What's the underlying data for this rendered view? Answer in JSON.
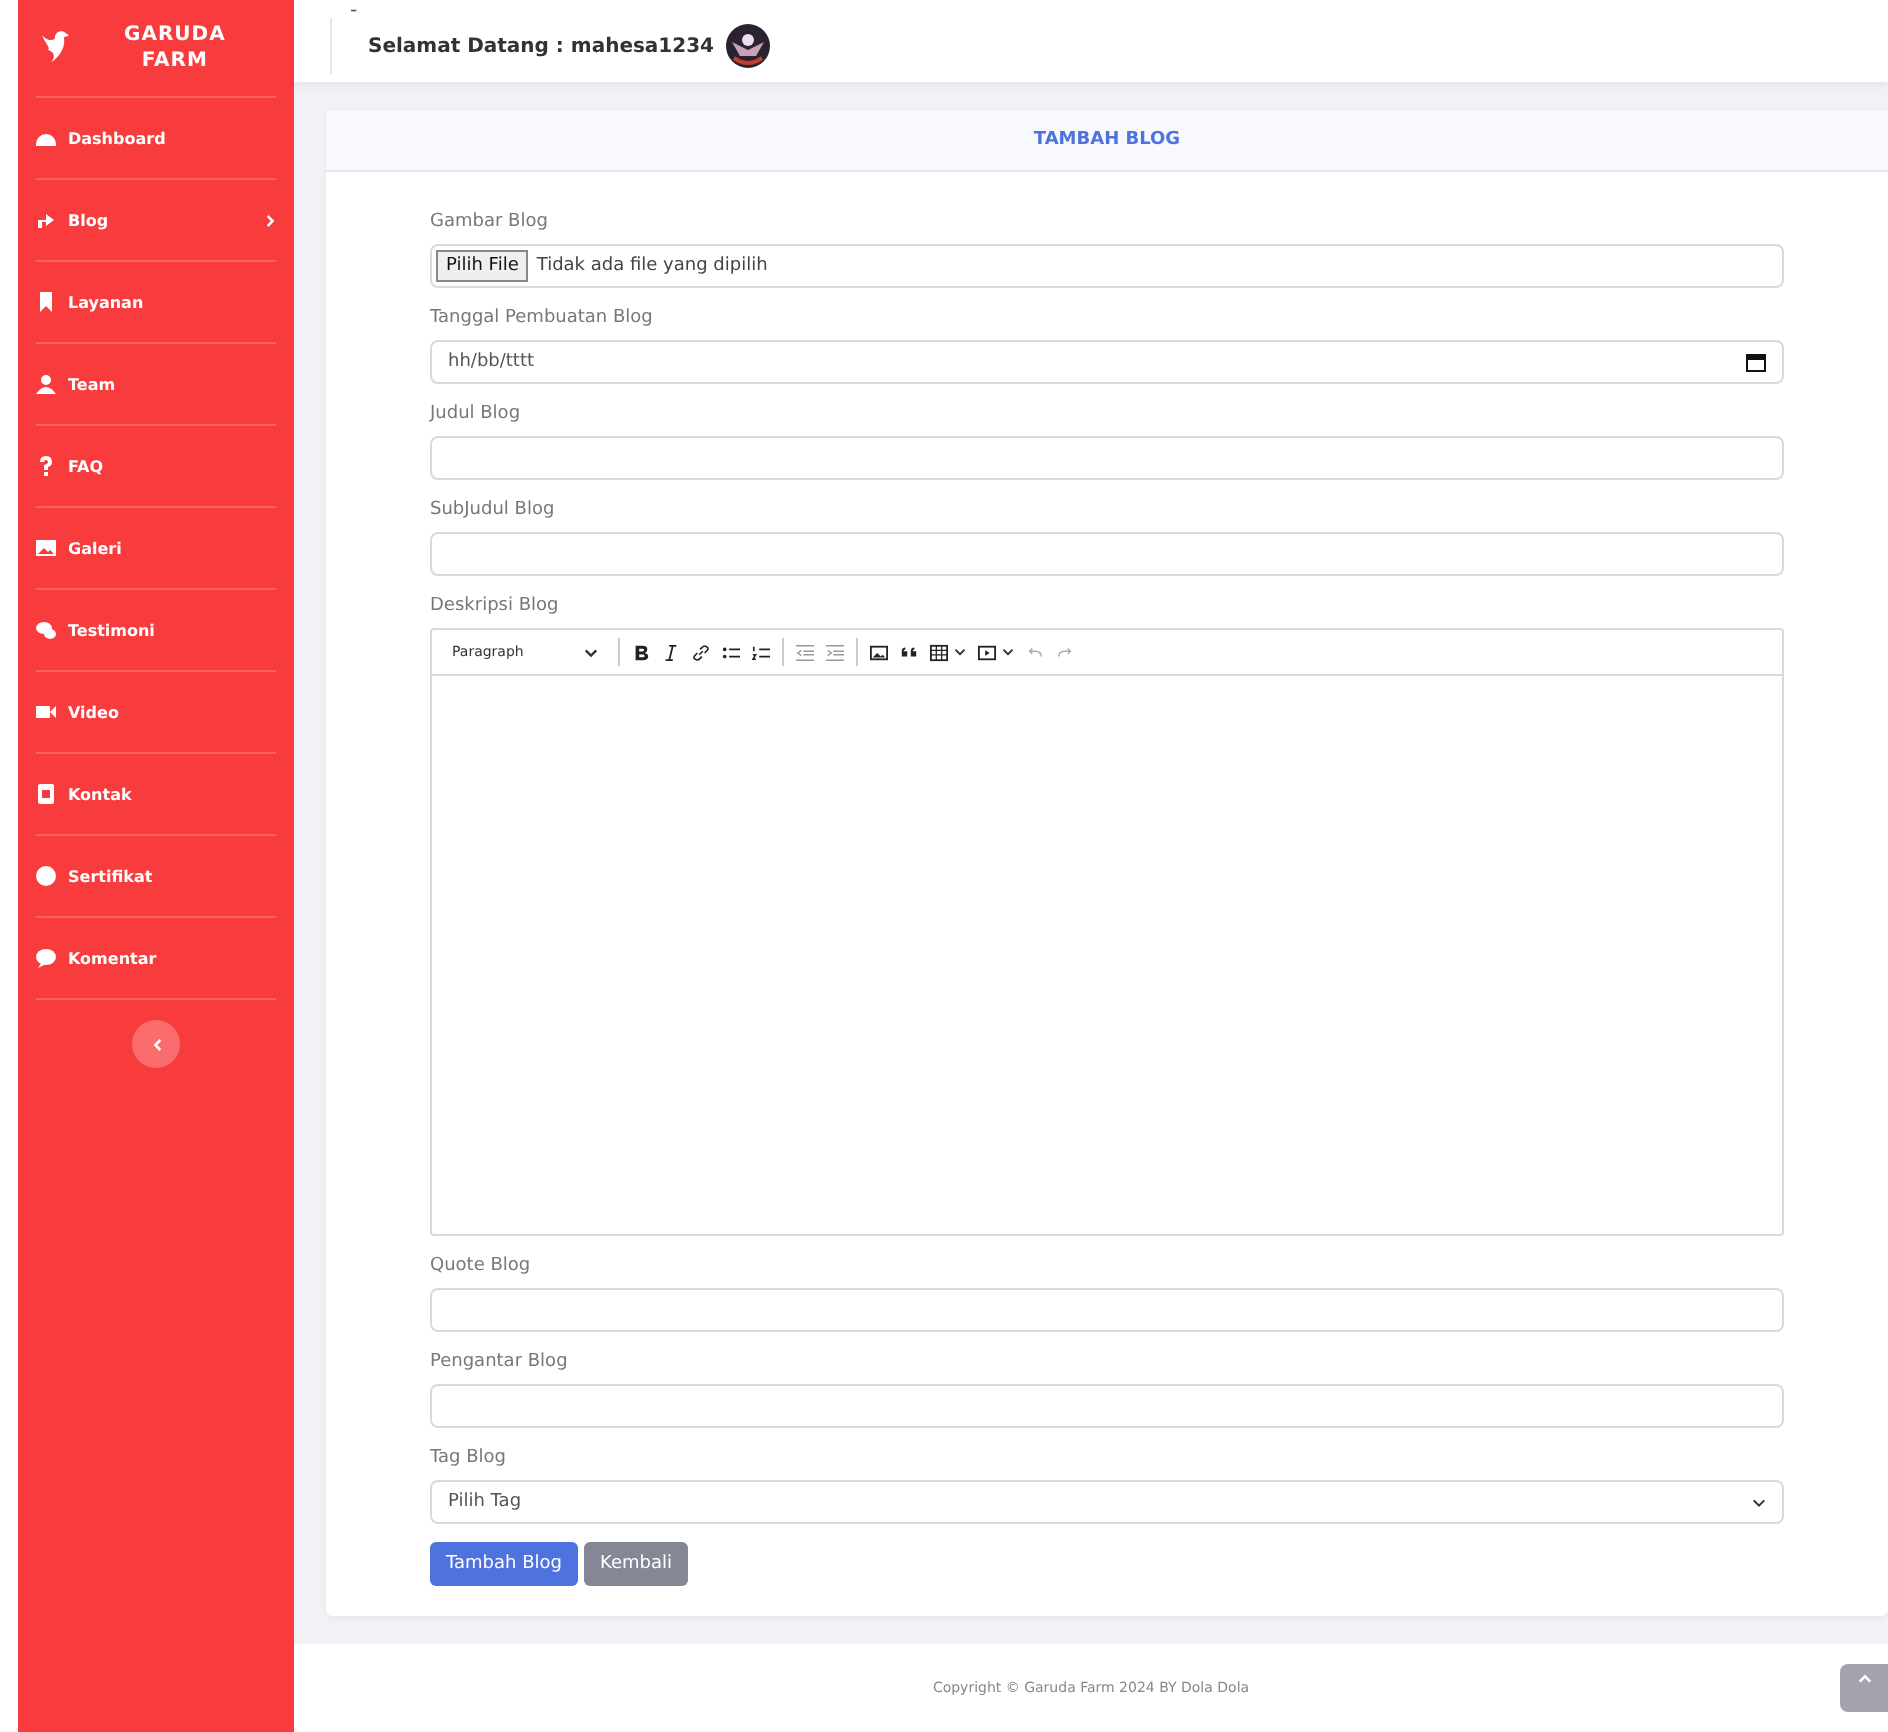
{
  "sidebar": {
    "brand": [
      "GARUDA",
      "FARM"
    ],
    "items": [
      {
        "label": "Dashboard",
        "expandable": false
      },
      {
        "label": "Blog",
        "expandable": true
      },
      {
        "label": "Layanan",
        "expandable": false
      },
      {
        "label": "Team",
        "expandable": false
      },
      {
        "label": "FAQ",
        "expandable": false
      },
      {
        "label": "Galeri",
        "expandable": false
      },
      {
        "label": "Testimoni",
        "expandable": false
      },
      {
        "label": "Video",
        "expandable": false
      },
      {
        "label": "Kontak",
        "expandable": false
      },
      {
        "label": "Sertifikat",
        "expandable": false
      },
      {
        "label": "Komentar",
        "expandable": false
      }
    ]
  },
  "header": {
    "marker": "-",
    "greeting": "Selamat Datang : mahesa1234"
  },
  "card": {
    "title": "TAMBAH BLOG",
    "fields": [
      {
        "kind": "file",
        "label": "Gambar Blog",
        "button": "Pilih File",
        "value": "Tidak ada file yang dipilih"
      },
      {
        "kind": "date",
        "label": "Tanggal Pembuatan Blog",
        "placeholder": "hh/bb/tttt"
      },
      {
        "kind": "text",
        "label": "Judul Blog"
      },
      {
        "kind": "text",
        "label": "SubJudul Blog"
      },
      {
        "kind": "editor",
        "label": "Deskripsi Blog",
        "style": "Paragraph"
      },
      {
        "kind": "text",
        "label": "Quote Blog"
      },
      {
        "kind": "text",
        "label": "Pengantar Blog"
      },
      {
        "kind": "select",
        "label": "Tag Blog",
        "value": "Pilih Tag"
      }
    ],
    "buttons": [
      {
        "label": "Tambah Blog",
        "kind": "primary"
      },
      {
        "label": "Kembali",
        "kind": "secondary"
      }
    ]
  },
  "footer": "Copyright © Garuda Farm 2024 BY Dola Dola"
}
